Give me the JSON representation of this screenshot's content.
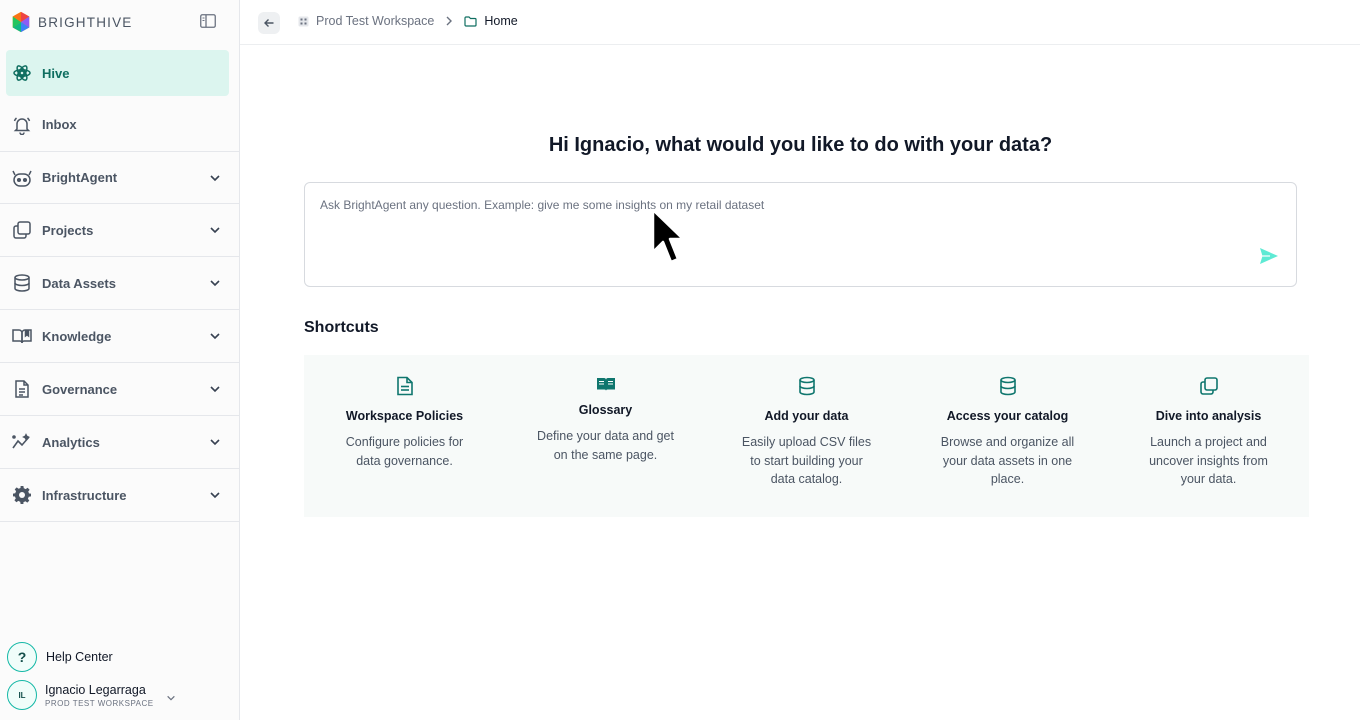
{
  "brand": {
    "name": "BRIGHTHIVE",
    "logo": "brighthive-logo-icon"
  },
  "sidebar": {
    "items": [
      {
        "label": "Hive",
        "icon": "hive-icon",
        "active": true,
        "expandable": false
      },
      {
        "label": "Inbox",
        "icon": "bell-icon",
        "active": false,
        "expandable": false
      },
      {
        "label": "BrightAgent",
        "icon": "robot-icon",
        "active": false,
        "expandable": true
      },
      {
        "label": "Projects",
        "icon": "projects-icon",
        "active": false,
        "expandable": true
      },
      {
        "label": "Data Assets",
        "icon": "database-icon",
        "active": false,
        "expandable": true
      },
      {
        "label": "Knowledge",
        "icon": "book-icon",
        "active": false,
        "expandable": true
      },
      {
        "label": "Governance",
        "icon": "document-icon",
        "active": false,
        "expandable": true
      },
      {
        "label": "Analytics",
        "icon": "analytics-icon",
        "active": false,
        "expandable": true
      },
      {
        "label": "Infrastructure",
        "icon": "gear-icon",
        "active": false,
        "expandable": true
      }
    ],
    "help": {
      "label": "Help Center",
      "icon_text": "?"
    },
    "user": {
      "initials": "IL",
      "name": "Ignacio Legarraga",
      "workspace": "PROD TEST WORKSPACE"
    }
  },
  "breadcrumb": {
    "items": [
      {
        "label": "Prod Test Workspace",
        "icon": "workspace-icon"
      },
      {
        "label": "Home",
        "icon": "folder-icon"
      }
    ]
  },
  "main": {
    "greeting": "Hi Ignacio, what would you like to do with your data?",
    "ask": {
      "value": "",
      "placeholder": "Ask BrightAgent any question. Example: give me some insights on my retail dataset"
    },
    "shortcuts_title": "Shortcuts",
    "shortcuts": [
      {
        "title": "Workspace Policies",
        "description": "Configure policies for data governance.",
        "icon": "document-icon"
      },
      {
        "title": "Glossary",
        "description": "Define your data and get on the same page.",
        "icon": "open-book-icon"
      },
      {
        "title": "Add your data",
        "description": "Easily upload CSV files to start building your data catalog.",
        "icon": "database-icon"
      },
      {
        "title": "Access your catalog",
        "description": "Browse and organize all your data assets in one place.",
        "icon": "database-icon"
      },
      {
        "title": "Dive into analysis",
        "description": "Launch a project and uncover insights from your data.",
        "icon": "copy-icon"
      }
    ]
  },
  "colors": {
    "accent": "#14b8a6",
    "accent_dark": "#0f6e60",
    "active_bg": "#dcf5ef",
    "card_bg": "#f7faf9"
  }
}
